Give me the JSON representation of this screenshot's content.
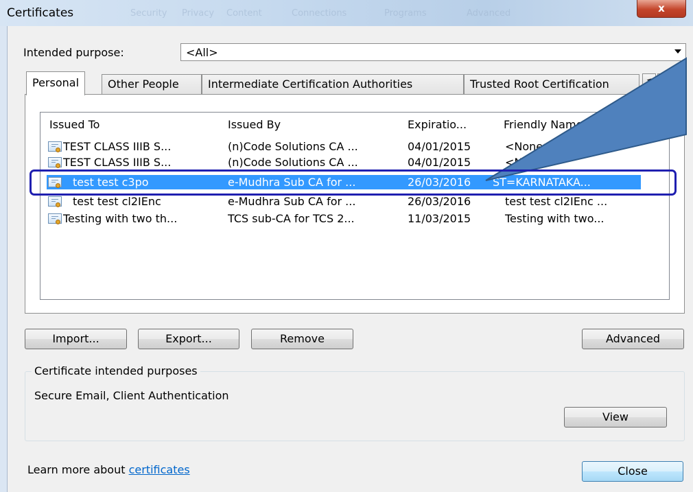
{
  "window": {
    "title": "Certificates",
    "close_glyph": "x"
  },
  "background_tabs": [
    "Security",
    "Privacy",
    "Content",
    "Connections",
    "Programs",
    "Advanced"
  ],
  "purpose": {
    "label": "Intended purpose:",
    "value": "<All>"
  },
  "tabs": [
    {
      "label": "Personal",
      "active": true
    },
    {
      "label": "Other People",
      "active": false
    },
    {
      "label": "Intermediate Certification Authorities",
      "active": false
    },
    {
      "label": "Trusted Root Certification",
      "active": false
    }
  ],
  "tab_scroll": {
    "left": "◄",
    "right": "►"
  },
  "columns": [
    "Issued To",
    "Issued By",
    "Expiratio...",
    "Friendly Name"
  ],
  "rows": [
    {
      "issued_to": "TEST CLASS IIIB S...",
      "issued_by": "(n)Code Solutions CA ...",
      "expiration": "04/01/2015",
      "friendly": "<None>",
      "selected": false
    },
    {
      "issued_to": "TEST CLASS IIIB S...",
      "issued_by": "(n)Code Solutions CA ...",
      "expiration": "04/01/2015",
      "friendly": "<None>",
      "selected": false
    },
    {
      "issued_to": "test test c3po",
      "issued_by": "e-Mudhra Sub CA for ...",
      "expiration": "26/03/2016",
      "friendly": "ST=KARNATAKA...",
      "selected": true
    },
    {
      "issued_to": "test test cl2IEnc",
      "issued_by": "e-Mudhra Sub CA for ...",
      "expiration": "26/03/2016",
      "friendly": "test test cl2IEnc ...",
      "selected": false
    },
    {
      "issued_to": "Testing with two th...",
      "issued_by": "TCS sub-CA for TCS 2...",
      "expiration": "11/03/2015",
      "friendly": "Testing with two...",
      "selected": false
    }
  ],
  "buttons": {
    "import": "Import...",
    "export": "Export...",
    "remove": "Remove",
    "advanced": "Advanced",
    "view": "View",
    "close": "Close"
  },
  "purposes_group": {
    "title": "Certificate intended purposes",
    "text": "Secure Email, Client Authentication"
  },
  "footer": {
    "prefix": "Learn more about ",
    "link": "certificates"
  },
  "colors": {
    "selection": "#3399ff",
    "callout_fill": "#4f81bd",
    "callout_border": "#1f1fb0",
    "link": "#0066cc"
  }
}
